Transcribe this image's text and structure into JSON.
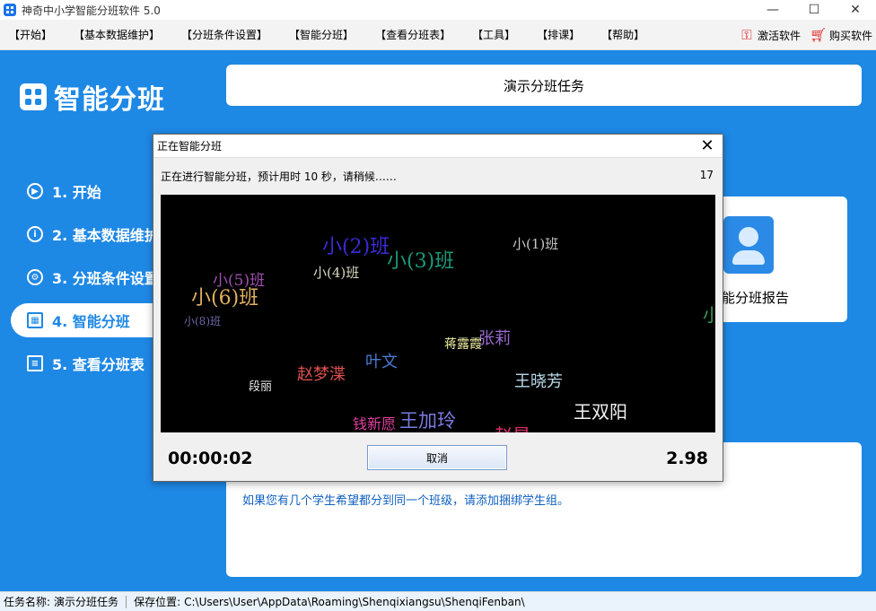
{
  "window": {
    "title": "神奇中小学智能分班软件 5.0",
    "controls": [
      "—",
      "☐",
      "✕"
    ]
  },
  "menu": {
    "items": [
      "【开始】",
      "【基本数据维护】",
      "【分班条件设置】",
      "【智能分班】",
      "【查看分班表】",
      "【工具】",
      "【排课】",
      "【帮助】"
    ],
    "activate": "激活软件",
    "buy": "购买软件"
  },
  "sidebar": {
    "brand": "智能分班",
    "items": [
      {
        "label": "1. 开始",
        "icon": "play-icon",
        "glyph": "▶"
      },
      {
        "label": "2. 基本数据维护",
        "icon": "info-icon",
        "glyph": "i"
      },
      {
        "label": "3. 分班条件设置",
        "icon": "gear-icon",
        "glyph": "⚙"
      },
      {
        "label": "4. 智能分班",
        "icon": "calculator-icon",
        "glyph": "▦",
        "active": true
      },
      {
        "label": "5. 查看分班表",
        "icon": "search-list-icon",
        "glyph": "≡"
      }
    ]
  },
  "main": {
    "task_name": "演示分班任务",
    "report_label": "能分班报告",
    "tip": "如果您有几个学生希望都分到同一个班级，请添加捆绑学生组。"
  },
  "status": {
    "task_label": "任务名称:",
    "task_value": "演示分班任务",
    "path_label": "保存位置:",
    "path_value": "C:\\Users\\User\\AppData\\Roaming\\Shenqixiangsu\\ShenqiFenban\\"
  },
  "dialog": {
    "title": "正在智能分班",
    "message": "正在进行智能分班，预计用时 10 秒，请稍候……",
    "count": "17",
    "elapsed": "00:00:02",
    "cancel": "取消",
    "value": "2.98",
    "words": [
      {
        "text": "小(2)班",
        "color": "#3a2bd6",
        "size": 22,
        "serif": true
      },
      {
        "text": "小(1)班",
        "color": "#c8c8c8",
        "size": 15,
        "serif": true
      },
      {
        "text": "小(3)班",
        "color": "#1a9a7a",
        "size": 22,
        "serif": true
      },
      {
        "text": "小(4)班",
        "color": "#d8d8c0",
        "size": 15,
        "serif": true
      },
      {
        "text": "小(5)班",
        "color": "#a050b0",
        "size": 17,
        "serif": true
      },
      {
        "text": "小(6)班",
        "color": "#e0b060",
        "size": 22,
        "serif": true
      },
      {
        "text": "小(8)班",
        "color": "#6a6aa8",
        "size": 12,
        "serif": true
      },
      {
        "text": "小",
        "color": "#3a9a5a",
        "size": 20,
        "serif": true
      },
      {
        "text": "蒋露霞",
        "color": "#f0f0a0",
        "size": 14,
        "serif": false
      },
      {
        "text": "张莉",
        "color": "#9a6ad0",
        "size": 18,
        "serif": false
      },
      {
        "text": "叶文",
        "color": "#4a7ad0",
        "size": 18,
        "serif": false
      },
      {
        "text": "赵梦渫",
        "color": "#e05050",
        "size": 18,
        "serif": false
      },
      {
        "text": "王晓芳",
        "color": "#b8d8e8",
        "size": 18,
        "serif": false
      },
      {
        "text": "段丽",
        "color": "#e8e8e8",
        "size": 13,
        "serif": false
      },
      {
        "text": "王双阳",
        "color": "#f0f0f0",
        "size": 20,
        "serif": false
      },
      {
        "text": "钱新愿",
        "color": "#e040a0",
        "size": 16,
        "serif": false
      },
      {
        "text": "王加玲",
        "color": "#7a7ae0",
        "size": 21,
        "serif": false
      },
      {
        "text": "赵昊",
        "color": "#e03070",
        "size": 20,
        "serif": false
      }
    ]
  }
}
